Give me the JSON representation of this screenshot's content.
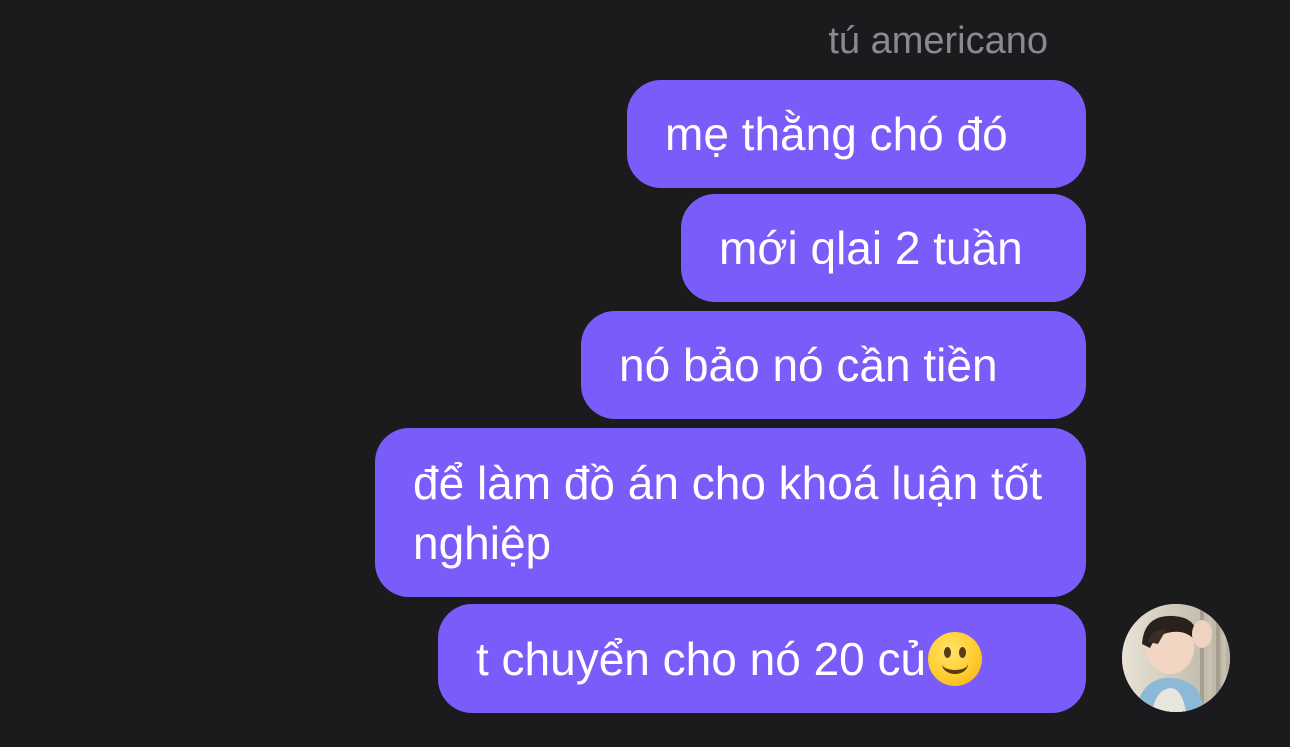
{
  "conversation": {
    "sender_name": "tú americano",
    "messages": [
      {
        "text": "mẹ thằng chó đó"
      },
      {
        "text": "mới qlai 2 tuần"
      },
      {
        "text": "nó bảo nó cần tiền"
      },
      {
        "text": "để làm đồ án cho khoá luận tốt nghiệp"
      },
      {
        "text": "t chuyển cho nó 20 củ"
      }
    ],
    "last_message_emoji": "slightly-smiling-face-icon"
  },
  "colors": {
    "background": "#1b1a1d",
    "bubble": "#7a5cfa",
    "sender_name": "#8a8a8e",
    "bubble_text": "#ffffff"
  }
}
